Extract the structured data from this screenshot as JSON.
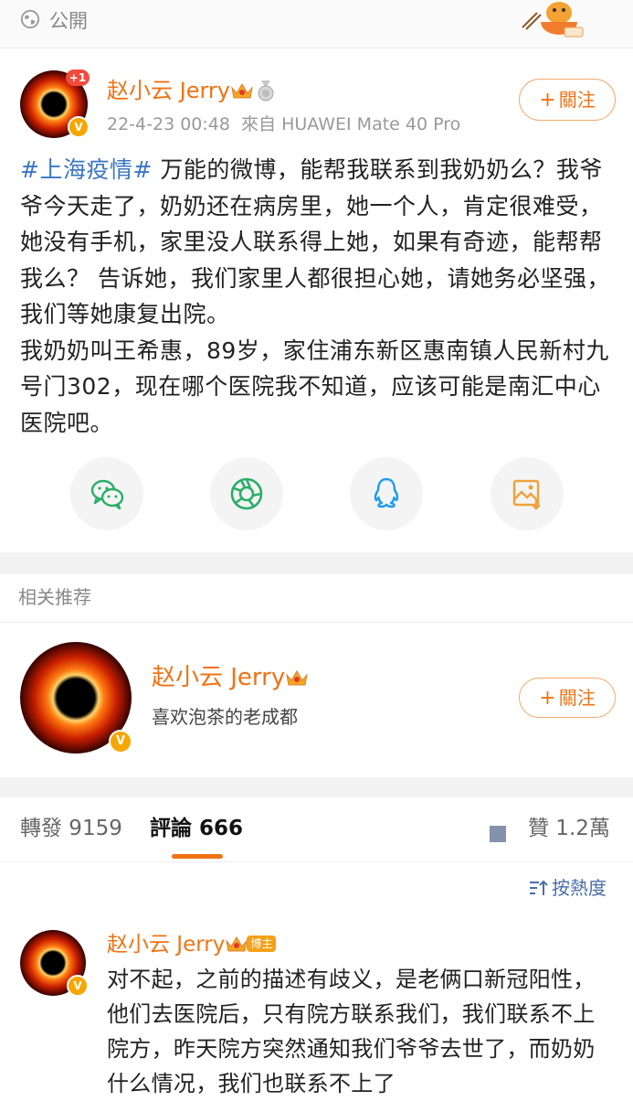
{
  "privacy": {
    "label": "公開",
    "icon": "globe-icon"
  },
  "post": {
    "author": "赵小云 Jerry",
    "notification_badge": "+1",
    "verified_badge": "V",
    "timestamp": "22-4-23 00:48",
    "source": "來自 HUAWEI Mate 40 Pro",
    "follow_label": "關注",
    "hashtag": "#上海疫情#",
    "paragraph1": " 万能的微博，能帮我联系到我奶奶么？我爷爷今天走了，奶奶还在病房里，她一个人，肯定很难受，她没有手机，家里没人联系得上她，如果有奇迹，能帮帮我么？ 告诉她，我们家里人都很担心她，请她务必坚强，我们等她康复出院。",
    "paragraph2": "我奶奶叫王希惠，89岁，家住浦东新区惠南镇人民新村九号门302，现在哪个医院我不知道，应该可能是南汇中心医院吧。"
  },
  "share": [
    {
      "icon": "wechat-icon"
    },
    {
      "icon": "moments-icon"
    },
    {
      "icon": "qq-icon"
    },
    {
      "icon": "save-image-icon"
    }
  ],
  "related": {
    "title": "相关推荐",
    "user": {
      "name": "赵小云 Jerry",
      "bio": "喜欢泡茶的老成都",
      "follow_label": "關注"
    }
  },
  "stats": {
    "repost_label": "轉發 9159",
    "comment_label": "評論 666",
    "like_label": "贊 1.2萬"
  },
  "sort": {
    "label": "按熱度"
  },
  "comment": {
    "author": "赵小云 Jerry",
    "host_badge": "博主",
    "text": "对不起，之前的描述有歧义，是老俩口新冠阳性，他们去医院后，只有院方联系我们，我们联系不上院方，昨天院方突然通知我们爷爷去世了，而奶奶什么情况，我们也联系不上了"
  },
  "colors": {
    "accent": "#f07214",
    "link": "#3b76c2",
    "verified": "#f7a600",
    "badge_red": "#f24b3d"
  }
}
